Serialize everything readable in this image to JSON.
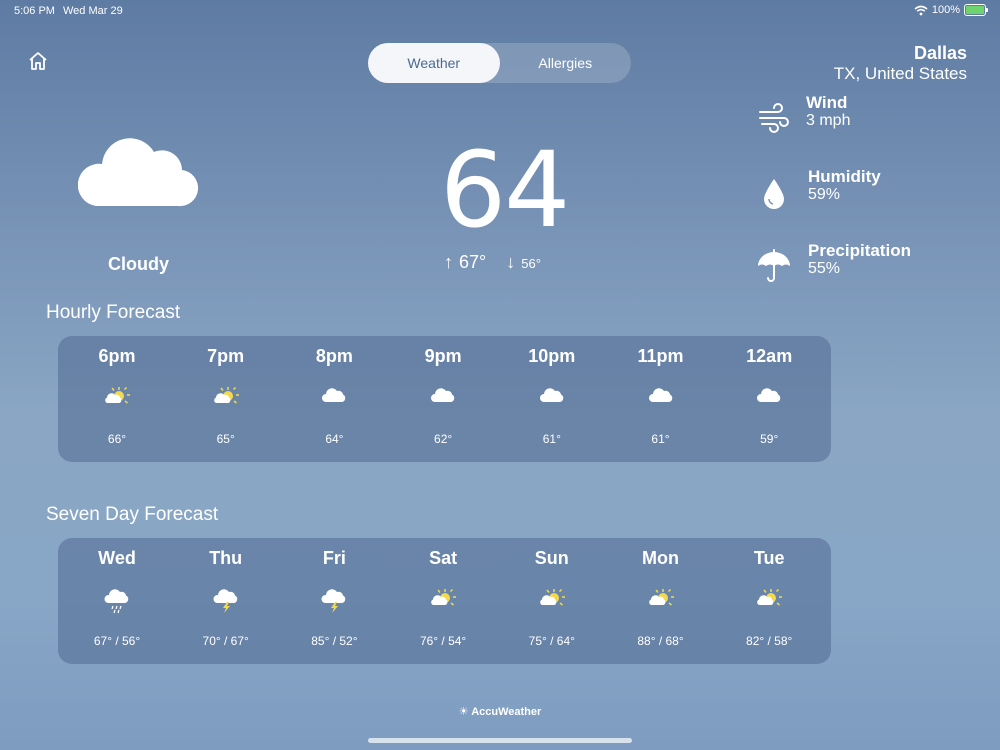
{
  "status": {
    "time": "5:06 PM",
    "date": "Wed Mar 29",
    "battery": "100%",
    "battery_level": 1.0
  },
  "tabs": [
    {
      "label": "Weather",
      "active": true
    },
    {
      "label": "Allergies",
      "active": false
    }
  ],
  "location": {
    "city": "Dallas",
    "region": "TX, United States"
  },
  "current": {
    "condition": "Cloudy",
    "temp": "64",
    "high": "67°",
    "low": "56°",
    "icon": "cloud-icon"
  },
  "details": [
    {
      "label": "Wind",
      "value": "3 mph",
      "icon": "wind-icon"
    },
    {
      "label": "Humidity",
      "value": "59%",
      "icon": "humidity-drop-icon"
    },
    {
      "label": "Precipitation",
      "value": "55%",
      "icon": "umbrella-icon"
    }
  ],
  "hourly": {
    "title": "Hourly Forecast",
    "items": [
      {
        "time": "6pm",
        "temp": "66°",
        "icon": "partly-sunny-icon"
      },
      {
        "time": "7pm",
        "temp": "65°",
        "icon": "partly-sunny-icon"
      },
      {
        "time": "8pm",
        "temp": "64°",
        "icon": "cloud-icon"
      },
      {
        "time": "9pm",
        "temp": "62°",
        "icon": "cloud-icon"
      },
      {
        "time": "10pm",
        "temp": "61°",
        "icon": "cloud-icon"
      },
      {
        "time": "11pm",
        "temp": "61°",
        "icon": "cloud-icon"
      },
      {
        "time": "12am",
        "temp": "59°",
        "icon": "cloud-icon"
      }
    ]
  },
  "daily": {
    "title": "Seven Day Forecast",
    "items": [
      {
        "day": "Wed",
        "range": "67° / 56°",
        "icon": "rain-cloud-icon"
      },
      {
        "day": "Thu",
        "range": "70° / 67°",
        "icon": "thunder-cloud-icon"
      },
      {
        "day": "Fri",
        "range": "85° / 52°",
        "icon": "thunder-cloud-icon"
      },
      {
        "day": "Sat",
        "range": "76° / 54°",
        "icon": "partly-sunny-icon"
      },
      {
        "day": "Sun",
        "range": "75° / 64°",
        "icon": "partly-sunny-icon"
      },
      {
        "day": "Mon",
        "range": "88° / 68°",
        "icon": "partly-sunny-icon"
      },
      {
        "day": "Tue",
        "range": "82° / 58°",
        "icon": "partly-sunny-icon"
      }
    ]
  },
  "footer": {
    "brand": "AccuWeather"
  },
  "colors": {
    "sun": "#f2d94e",
    "active_tab_text": "#4a6a91"
  }
}
